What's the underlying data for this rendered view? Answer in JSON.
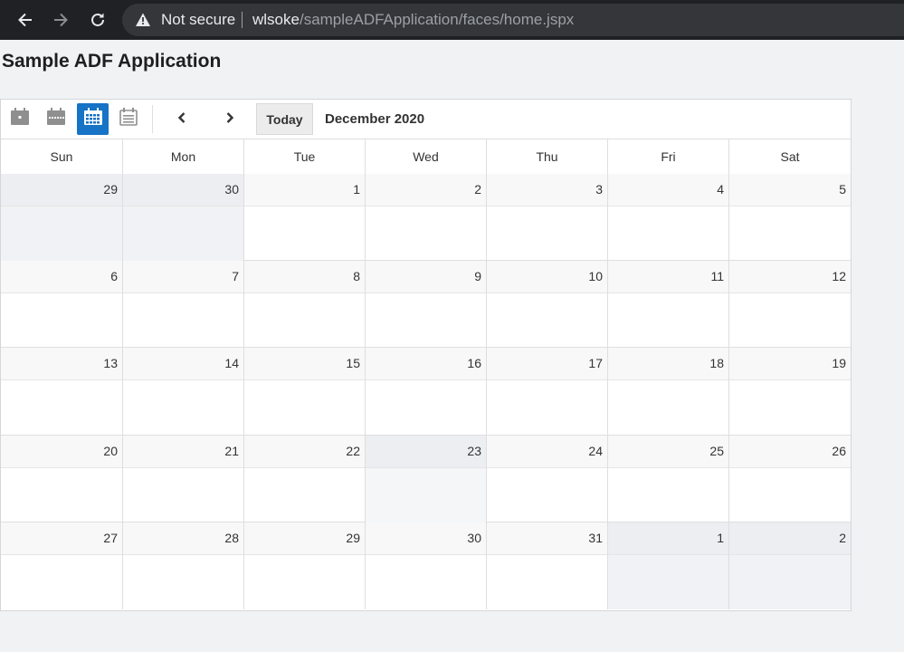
{
  "browser": {
    "security_label": "Not secure",
    "url_host": "wlsoke",
    "url_path": "/sampleADFApplication/faces/home.jspx"
  },
  "page": {
    "title": "Sample ADF Application"
  },
  "calendar": {
    "active_view": "month",
    "view_icons": [
      "day-view-icon",
      "week-view-icon",
      "month-view-icon",
      "list-view-icon"
    ],
    "today_label": "Today",
    "month_label": "December 2020",
    "accent_color": "#1673c5",
    "days_of_week": [
      "Sun",
      "Mon",
      "Tue",
      "Wed",
      "Thu",
      "Fri",
      "Sat"
    ],
    "weeks": [
      [
        "29",
        "30",
        "1",
        "2",
        "3",
        "4",
        "5"
      ],
      [
        "6",
        "7",
        "8",
        "9",
        "10",
        "11",
        "12"
      ],
      [
        "13",
        "14",
        "15",
        "16",
        "17",
        "18",
        "19"
      ],
      [
        "20",
        "21",
        "22",
        "23",
        "24",
        "25",
        "26"
      ],
      [
        "27",
        "28",
        "29",
        "30",
        "31",
        "1",
        "2"
      ]
    ],
    "highlighted_day": "23"
  }
}
